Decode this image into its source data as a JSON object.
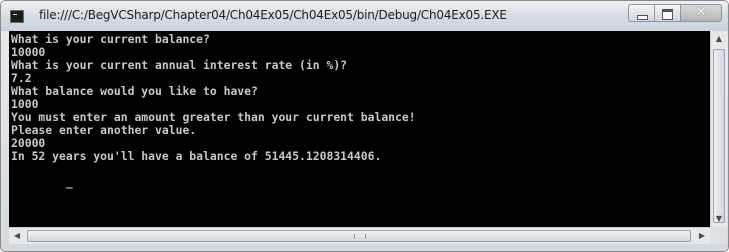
{
  "window": {
    "title": "file:///C:/BegVCSharp/Chapter04/Ch04Ex05/Ch04Ex05/bin/Debug/Ch04Ex05.EXE",
    "app_icon": "console-icon",
    "caption_buttons": {
      "minimize_icon": "minimize-icon",
      "maximize_icon": "maximize-icon",
      "close_label": "✕"
    }
  },
  "console": {
    "lines": [
      "What is your current balance?",
      "10000",
      "What is your current annual interest rate (in %)?",
      "7.2",
      "What balance would you like to have?",
      "1000",
      "You must enter an amount greater than your current balance!",
      "Please enter another value.",
      "20000",
      "In 52 years you'll have a balance of 51445.1208314406."
    ],
    "cursor": "_"
  },
  "scrollbars": {
    "up_arrow": "▲",
    "down_arrow": "▼",
    "left_arrow": "◀",
    "right_arrow": "▶"
  },
  "colors": {
    "console_background": "#000000",
    "console_text": "#c8c8c8"
  }
}
